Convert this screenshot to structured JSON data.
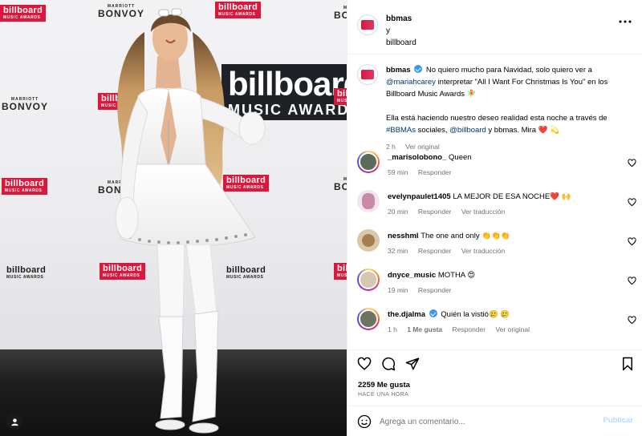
{
  "media": {
    "logos": {
      "billboard": "billboard",
      "music_awards": "MUSIC AWARDS",
      "marriott": "MARRIOTT",
      "bonvoy": "BONVOY"
    }
  },
  "header": {
    "username": "bbmas",
    "connector": "y",
    "collaborator": "billboard",
    "more_icon": "more-horizontal-icon"
  },
  "caption": {
    "username": "bbmas",
    "text_1": "No quiero mucho para Navidad, solo quiero ver a",
    "mention_1": "@mariahcarey",
    "text_2": "interpretar \"All I Want For Christmas Is You\" en los Billboard Music Awards 🧚",
    "text_3": "Ella está haciendo nuestro deseo realidad esta noche a través de",
    "hashtag": "#BBMAs",
    "text_4": "sociales,",
    "mention_2": "@billboard",
    "text_5": "y bbmas. Mira ❤️ 💫",
    "time": "2 h",
    "see_original": "Ver original"
  },
  "comments": [
    {
      "username": "_marisolobono_",
      "text": "Queen",
      "time": "59 min",
      "reply": "Responder",
      "extra": "",
      "likes": "",
      "verified": false
    },
    {
      "username": "evelynpaulet1405",
      "text": "LA MEJOR DE ESA NOCHE❤️ 🙌",
      "time": "20 min",
      "reply": "Responder",
      "extra": "Ver traducción",
      "likes": "",
      "verified": false
    },
    {
      "username": "nesshml",
      "text": "The one and only 👏👏👏",
      "time": "32 min",
      "reply": "Responder",
      "extra": "Ver traducción",
      "likes": "",
      "verified": false
    },
    {
      "username": "dnyce_music",
      "text": "MOTHA 😍",
      "time": "19 min",
      "reply": "Responder",
      "extra": "",
      "likes": "",
      "verified": false
    },
    {
      "username": "the.djalma",
      "text": "Quién la vistió🥲 🥲",
      "time": "1 h",
      "reply": "Responder",
      "extra": "Ver original",
      "likes": "1 Me gusta",
      "verified": true
    }
  ],
  "actions": {
    "likes": "2259 Me gusta",
    "timestamp": "HACE UNA HORA"
  },
  "composer": {
    "placeholder": "Agrega un comentario...",
    "post": "Publicar"
  },
  "colors": {
    "link": "#00376b",
    "verified": "#3897f0",
    "post_disabled": "#b3dbff",
    "billboard_red": "#d7193e"
  }
}
